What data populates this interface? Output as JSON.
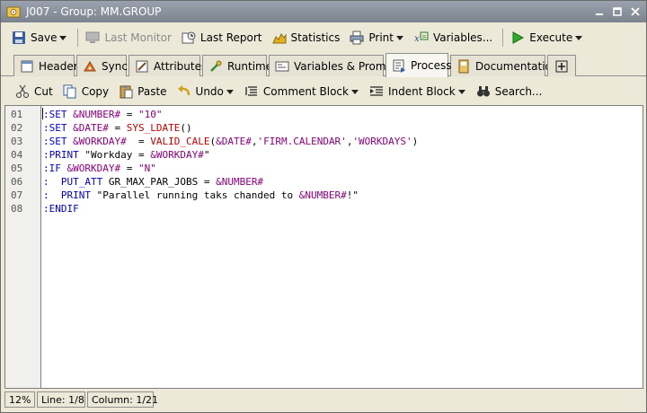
{
  "window": {
    "title": "J007 - Group: MM.GROUP"
  },
  "toolbar": {
    "save": "Save",
    "last_monitor": "Last Monitor",
    "last_report": "Last Report",
    "statistics": "Statistics",
    "print": "Print",
    "variables": "Variables...",
    "execute": "Execute"
  },
  "tabs": [
    {
      "label": "Header",
      "icon": "header-icon"
    },
    {
      "label": "Sync",
      "icon": "sync-icon"
    },
    {
      "label": "Attributes",
      "icon": "attributes-icon"
    },
    {
      "label": "Runtime",
      "icon": "runtime-icon"
    },
    {
      "label": "Variables & Prompts",
      "icon": "variables-prompts-icon"
    },
    {
      "label": "Process",
      "icon": "process-icon",
      "active": true
    },
    {
      "label": "Documentation",
      "icon": "documentation-icon"
    },
    {
      "label": "",
      "icon": "add-tab-icon"
    }
  ],
  "editor_toolbar": {
    "cut": "Cut",
    "copy": "Copy",
    "paste": "Paste",
    "undo": "Undo",
    "comment_block": "Comment Block",
    "indent_block": "Indent Block",
    "search": "Search..."
  },
  "editor": {
    "line_numbers": [
      "01",
      "02",
      "03",
      "04",
      "05",
      "06",
      "07",
      "08"
    ],
    "lines": [
      [
        {
          "t": ":SET",
          "c": "kw"
        },
        {
          "t": " ",
          "c": "txt"
        },
        {
          "t": "&NUMBER#",
          "c": "var"
        },
        {
          "t": " = ",
          "c": "txt"
        },
        {
          "t": "\"10\"",
          "c": "str"
        }
      ],
      [
        {
          "t": ":SET",
          "c": "kw"
        },
        {
          "t": " ",
          "c": "txt"
        },
        {
          "t": "&DATE#",
          "c": "var"
        },
        {
          "t": " = ",
          "c": "txt"
        },
        {
          "t": "SYS_LDATE",
          "c": "fn"
        },
        {
          "t": "()",
          "c": "txt"
        }
      ],
      [
        {
          "t": ":SET",
          "c": "kw"
        },
        {
          "t": " ",
          "c": "txt"
        },
        {
          "t": "&WORKDAY#",
          "c": "var"
        },
        {
          "t": "  = ",
          "c": "txt"
        },
        {
          "t": "VALID_CALE",
          "c": "fn"
        },
        {
          "t": "(",
          "c": "txt"
        },
        {
          "t": "&DATE#",
          "c": "var"
        },
        {
          "t": ",",
          "c": "txt"
        },
        {
          "t": "'FIRM.CALENDAR'",
          "c": "str"
        },
        {
          "t": ",",
          "c": "txt"
        },
        {
          "t": "'WORKDAYS'",
          "c": "str"
        },
        {
          "t": ")",
          "c": "txt"
        }
      ],
      [
        {
          "t": ":PRINT",
          "c": "kw"
        },
        {
          "t": " \"Workday = ",
          "c": "txt"
        },
        {
          "t": "&WORKDAY#",
          "c": "var"
        },
        {
          "t": "\"",
          "c": "txt"
        }
      ],
      [
        {
          "t": ":IF",
          "c": "kw"
        },
        {
          "t": " ",
          "c": "txt"
        },
        {
          "t": "&WORKDAY#",
          "c": "var"
        },
        {
          "t": " = ",
          "c": "txt"
        },
        {
          "t": "\"N\"",
          "c": "str"
        }
      ],
      [
        {
          "t": ":",
          "c": "kw"
        },
        {
          "t": "  ",
          "c": "txt"
        },
        {
          "t": "PUT_ATT",
          "c": "kw"
        },
        {
          "t": " GR_MAX_PAR_JOBS = ",
          "c": "txt"
        },
        {
          "t": "&NUMBER#",
          "c": "var"
        }
      ],
      [
        {
          "t": ":",
          "c": "kw"
        },
        {
          "t": "  ",
          "c": "txt"
        },
        {
          "t": "PRINT",
          "c": "kw"
        },
        {
          "t": " \"Parallel running taks chanded to ",
          "c": "txt"
        },
        {
          "t": "&NUMBER#",
          "c": "var"
        },
        {
          "t": "!\"",
          "c": "txt"
        }
      ],
      [
        {
          "t": ":ENDIF",
          "c": "kw"
        }
      ]
    ]
  },
  "status": {
    "zoom": "12%",
    "line": "Line: 1/8",
    "column": "Column: 1/21"
  },
  "colors": {
    "keyword": "#0000c0",
    "variable": "#8b0080",
    "function": "#c00000"
  }
}
